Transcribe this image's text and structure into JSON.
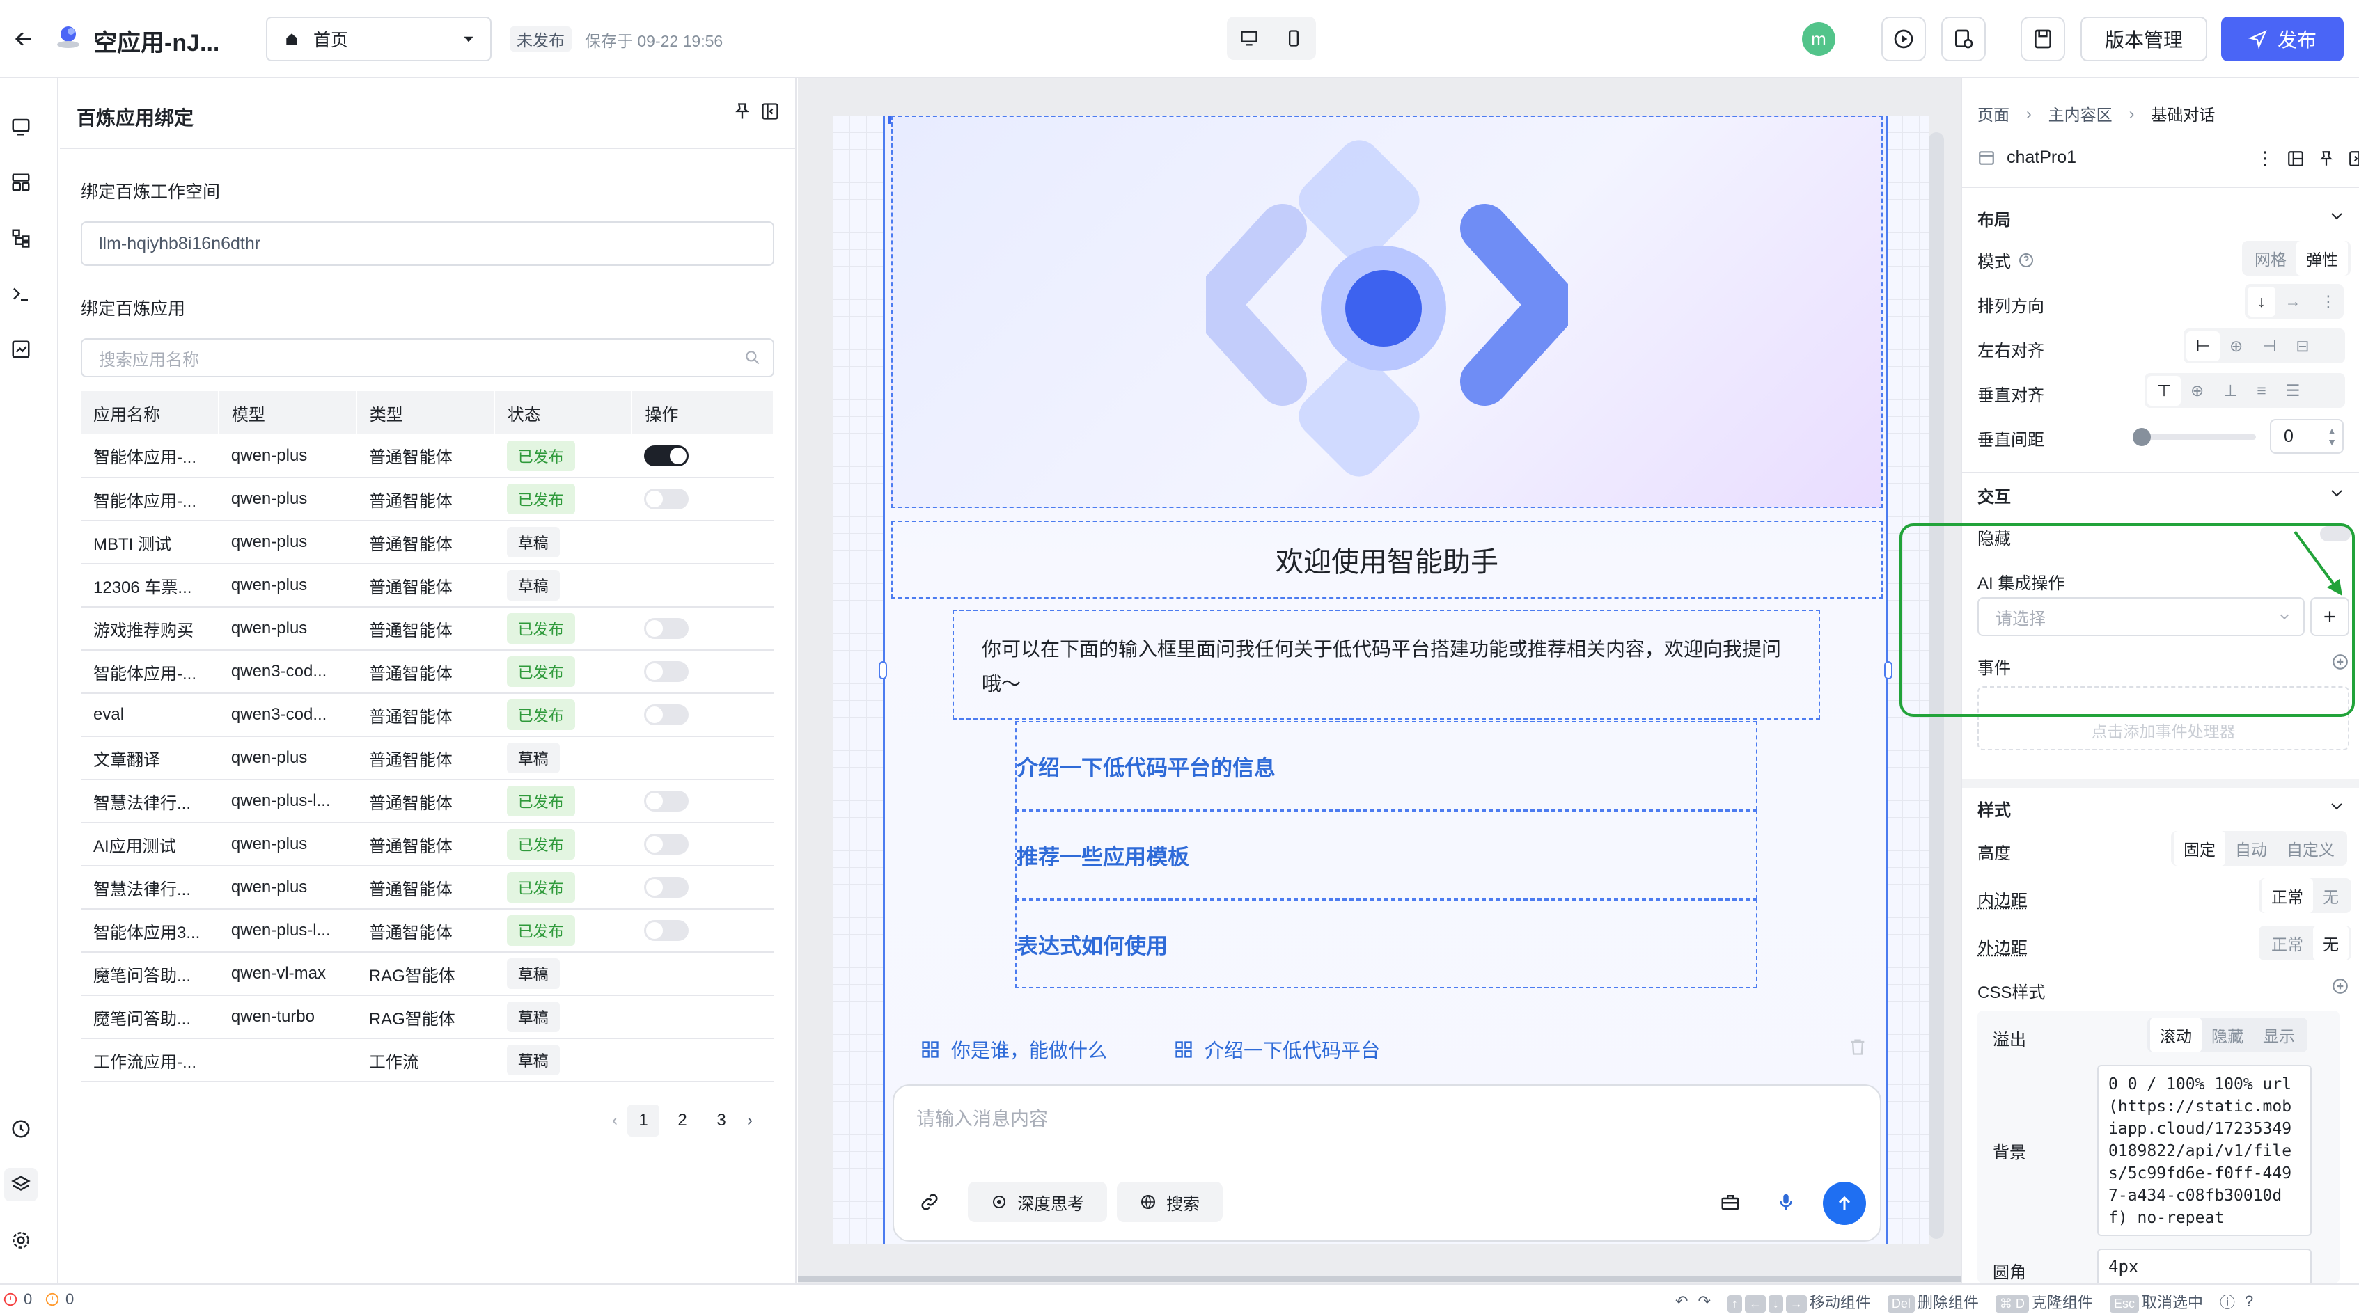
{
  "topbar": {
    "app_title": "空应用-nJ...",
    "page_select": "首页",
    "status_badge": "未发布",
    "saved_text": "保存于 09-22 19:56",
    "avatar_letter": "m",
    "version_label": "版本管理",
    "publish_label": "发布"
  },
  "left_panel": {
    "title": "百炼应用绑定",
    "workspace_label": "绑定百炼工作空间",
    "workspace_value": "llm-hqiyhb8i16n6dthr",
    "app_label": "绑定百炼应用",
    "search_placeholder": "搜索应用名称",
    "columns": [
      "应用名称",
      "模型",
      "类型",
      "状态",
      "操作"
    ],
    "rows": [
      {
        "name": "智能体应用-...",
        "model": "qwen-plus",
        "type": "普通智能体",
        "status": "已发布",
        "published": true,
        "toggle": "on"
      },
      {
        "name": "智能体应用-...",
        "model": "qwen-plus",
        "type": "普通智能体",
        "status": "已发布",
        "published": true,
        "toggle": "off"
      },
      {
        "name": "MBTI 测试",
        "model": "qwen-plus",
        "type": "普通智能体",
        "status": "草稿",
        "published": false,
        "toggle": "none"
      },
      {
        "name": "12306 车票...",
        "model": "qwen-plus",
        "type": "普通智能体",
        "status": "草稿",
        "published": false,
        "toggle": "none"
      },
      {
        "name": "游戏推荐购买",
        "model": "qwen-plus",
        "type": "普通智能体",
        "status": "已发布",
        "published": true,
        "toggle": "off"
      },
      {
        "name": "智能体应用-...",
        "model": "qwen3-cod...",
        "type": "普通智能体",
        "status": "已发布",
        "published": true,
        "toggle": "off"
      },
      {
        "name": "eval",
        "model": "qwen3-cod...",
        "type": "普通智能体",
        "status": "已发布",
        "published": true,
        "toggle": "off"
      },
      {
        "name": "文章翻译",
        "model": "qwen-plus",
        "type": "普通智能体",
        "status": "草稿",
        "published": false,
        "toggle": "none"
      },
      {
        "name": "智慧法律行...",
        "model": "qwen-plus-l...",
        "type": "普通智能体",
        "status": "已发布",
        "published": true,
        "toggle": "off"
      },
      {
        "name": "AI应用测试",
        "model": "qwen-plus",
        "type": "普通智能体",
        "status": "已发布",
        "published": true,
        "toggle": "off"
      },
      {
        "name": "智慧法律行...",
        "model": "qwen-plus",
        "type": "普通智能体",
        "status": "已发布",
        "published": true,
        "toggle": "off"
      },
      {
        "name": "智能体应用3...",
        "model": "qwen-plus-l...",
        "type": "普通智能体",
        "status": "已发布",
        "published": true,
        "toggle": "off"
      },
      {
        "name": "魔笔问答助...",
        "model": "qwen-vl-max",
        "type": "RAG智能体",
        "status": "草稿",
        "published": false,
        "toggle": "none"
      },
      {
        "name": "魔笔问答助...",
        "model": "qwen-turbo",
        "type": "RAG智能体",
        "status": "草稿",
        "published": false,
        "toggle": "none"
      },
      {
        "name": "工作流应用-...",
        "model": "",
        "type": "工作流",
        "status": "草稿",
        "published": false,
        "toggle": "none"
      }
    ],
    "pages": [
      "1",
      "2",
      "3"
    ],
    "current_page": "1"
  },
  "canvas": {
    "welcome_title": "欢迎使用智能助手",
    "welcome_desc": "你可以在下面的输入框里面问我任何关于低代码平台搭建功能或推荐相关内容，欢迎向我提问哦～",
    "suggestions": [
      "介绍一下低代码平台的信息",
      "推荐一些应用模板",
      "表达式如何使用"
    ],
    "quick_prompts": [
      "你是谁，能做什么",
      "介绍一下低代码平台"
    ],
    "input_placeholder": "请输入消息内容",
    "deep_think_label": "深度思考",
    "search_label": "搜索"
  },
  "right_panel": {
    "breadcrumb": [
      "页面",
      "主内容区",
      "基础对话"
    ],
    "component_name": "chatPro1",
    "layout_section": "布局",
    "mode_label": "模式",
    "mode_options": [
      "网格",
      "弹性"
    ],
    "direction_label": "排列方向",
    "halign_label": "左右对齐",
    "valign_label": "垂直对齐",
    "vgap_label": "垂直间距",
    "vgap_value": "0",
    "vgap_slider_fraction": 0,
    "interaction_section": "交互",
    "hidden_label": "隐藏",
    "ai_label": "AI 集成操作",
    "ai_placeholder": "请选择",
    "events_label": "事件",
    "events_add_hint": "点击添加事件处理器",
    "style_section": "样式",
    "height_label": "高度",
    "height_options": [
      "固定",
      "自动",
      "自定义"
    ],
    "padding_label": "内边距",
    "padding_options": [
      "正常",
      "无"
    ],
    "margin_label": "外边距",
    "margin_options": [
      "正常",
      "无"
    ],
    "css_label": "CSS样式",
    "overflow_label": "溢出",
    "overflow_options": [
      "滚动",
      "隐藏",
      "显示"
    ],
    "background_label": "背景",
    "background_value": "0 0 / 100% 100% url(https://static.mobiapp.cloud/172353490189822/api/v1/files/5c99fd6e-f0ff-4497-a434-c08fb30010df) no-repeat",
    "radius_label": "圆角",
    "radius_value": "4px"
  },
  "statusbar": {
    "error_count": "0",
    "warn_count": "0",
    "move_label": "移动组件",
    "delete_key": "Del",
    "delete_label": "删除组件",
    "clone_key": "⌘ D",
    "clone_label": "克隆组件",
    "esc_key": "Esc",
    "cancel_label": "取消选中"
  },
  "colors": {
    "accent": "#4a65f6",
    "link": "#2f6bd8",
    "annotation": "#22a33a",
    "published_bg": "#e3f5e1",
    "published_fg": "#2f9a3b"
  }
}
